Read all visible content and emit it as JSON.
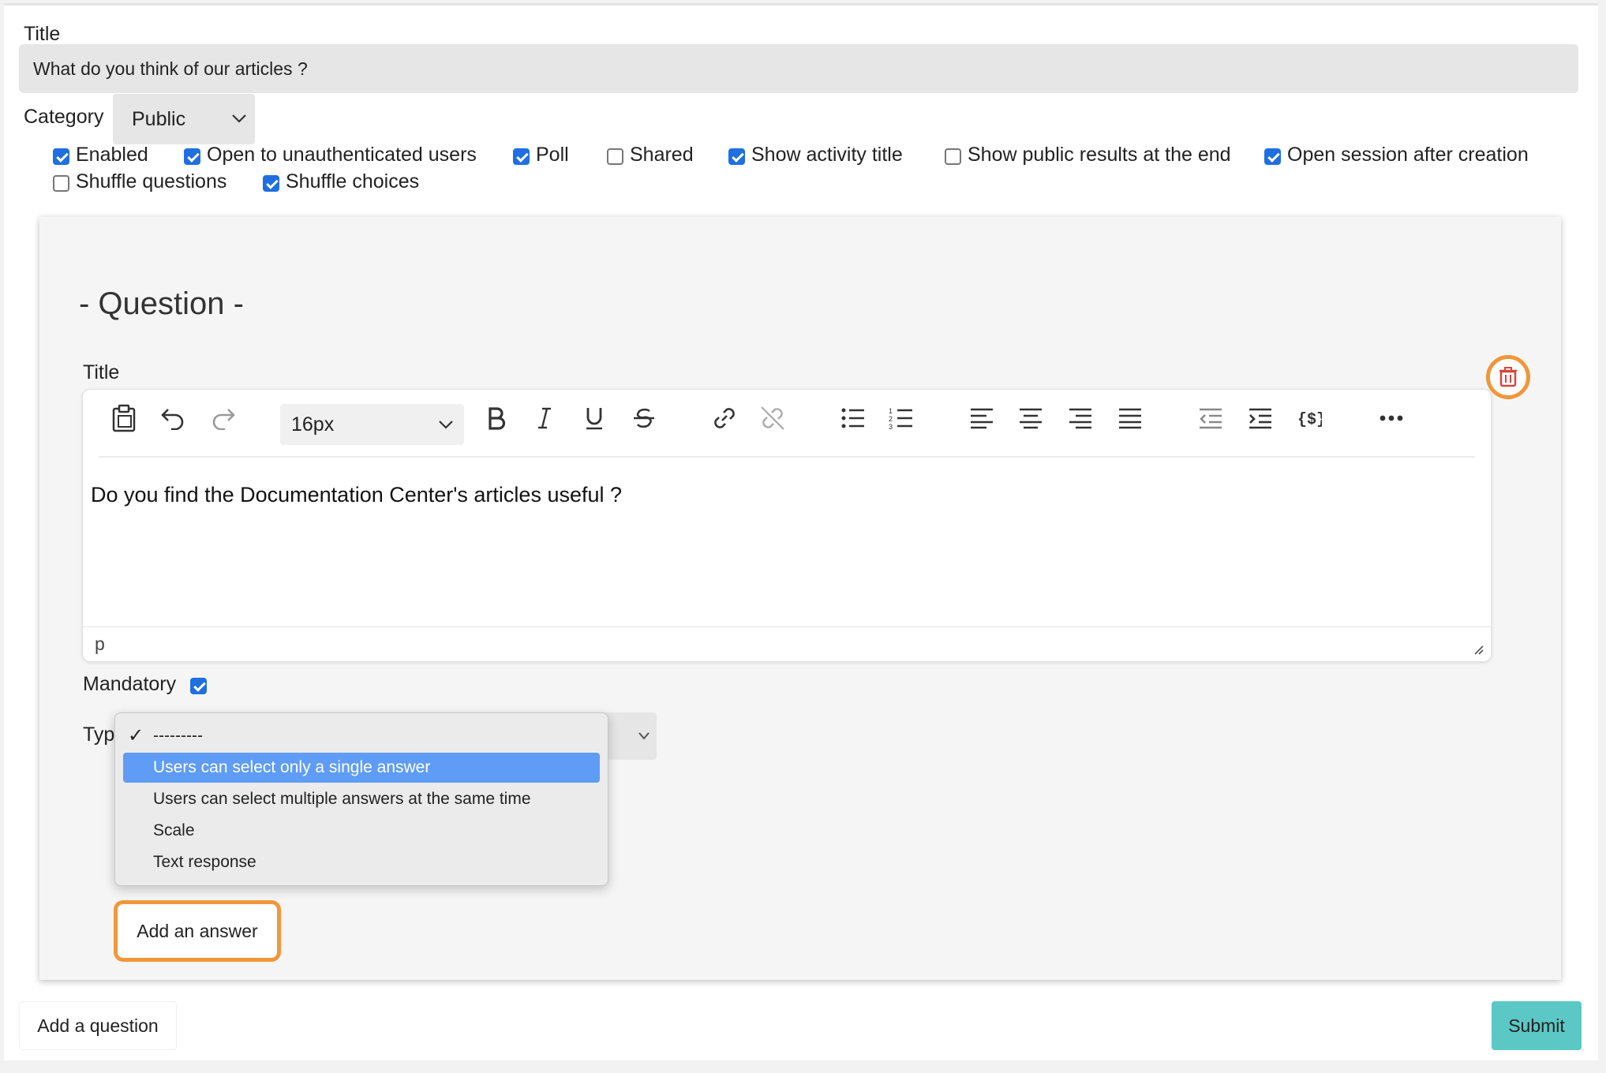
{
  "form": {
    "title_label": "Title",
    "title_value": "What do you think of our articles ?",
    "category_label": "Category",
    "category_value": "Public"
  },
  "options": [
    {
      "label": "Enabled",
      "checked": true
    },
    {
      "label": "Open to unauthenticated users",
      "checked": true
    },
    {
      "label": "Poll",
      "checked": true
    },
    {
      "label": "Shared",
      "checked": false
    },
    {
      "label": "Show activity title",
      "checked": true
    },
    {
      "label": "Show public results at the end",
      "checked": false
    },
    {
      "label": "Open session after creation",
      "checked": true
    },
    {
      "label": "Shuffle questions",
      "checked": false
    },
    {
      "label": "Shuffle choices",
      "checked": true
    }
  ],
  "question": {
    "heading": "- Question -",
    "title_label": "Title",
    "editor": {
      "font_size": "16px",
      "content": "Do you find the Documentation Center's articles useful ?",
      "status_path": "p"
    },
    "mandatory_label": "Mandatory",
    "mandatory_checked": true,
    "type_label": "Typ",
    "type_options": [
      {
        "label": "---------",
        "checked": true
      },
      {
        "label": "Users can select only a single answer",
        "highlighted": true
      },
      {
        "label": "Users can select multiple answers at the same time"
      },
      {
        "label": "Scale"
      },
      {
        "label": "Text response"
      }
    ],
    "add_answer_label": "Add an answer"
  },
  "footer": {
    "add_question_label": "Add a question",
    "submit_label": "Submit"
  },
  "colors": {
    "accent": "#1f6fe0",
    "highlight_ring": "#f1973a",
    "submit_bg": "#5bc8c6",
    "danger": "#d9453a"
  }
}
